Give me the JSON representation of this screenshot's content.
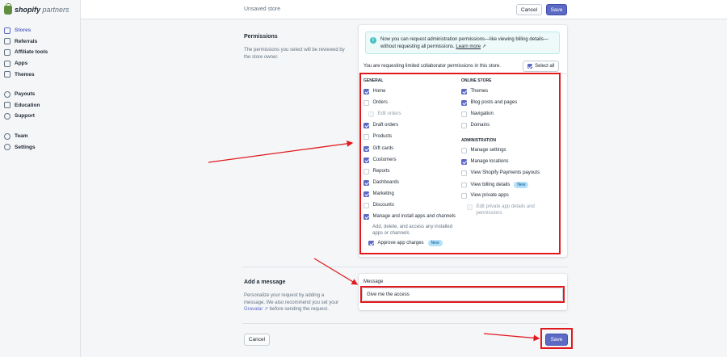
{
  "sidebar": {
    "logo_brand": "shopify",
    "logo_suffix": "partners",
    "items": [
      {
        "label": "Stores",
        "icon": "store-icon"
      },
      {
        "label": "Referrals",
        "icon": "referrals-icon"
      },
      {
        "label": "Affiliate tools",
        "icon": "affiliate-icon"
      },
      {
        "label": "Apps",
        "icon": "apps-icon"
      },
      {
        "label": "Themes",
        "icon": "themes-icon"
      },
      {
        "label": "Payouts",
        "icon": "payouts-icon"
      },
      {
        "label": "Education",
        "icon": "education-icon"
      },
      {
        "label": "Support",
        "icon": "support-icon"
      },
      {
        "label": "Team",
        "icon": "team-icon"
      },
      {
        "label": "Settings",
        "icon": "settings-icon"
      }
    ]
  },
  "topbar": {
    "title": "Unsaved store",
    "cancel_label": "Cancel",
    "save_label": "Save"
  },
  "permissions": {
    "title": "Permissions",
    "description": "The permissions you select will be reviewed by the store owner.",
    "banner_text": "Now you can request administration permissions—like viewing billing details—without requesting all permissions.",
    "banner_link": "Learn more",
    "request_text": "You are requesting limited collaborator permissions in this store.",
    "select_all_label": "Select all",
    "general_heading": "GENERAL",
    "online_store_heading": "ONLINE STORE",
    "administration_heading": "ADMINISTRATION",
    "general": [
      {
        "label": "Home",
        "checked": true
      },
      {
        "label": "Orders",
        "checked": false
      },
      {
        "label": "Edit orders",
        "checked": false,
        "disabled": true
      },
      {
        "label": "Draft orders",
        "checked": true
      },
      {
        "label": "Products",
        "checked": false
      },
      {
        "label": "Gift cards",
        "checked": true
      },
      {
        "label": "Customers",
        "checked": true
      },
      {
        "label": "Reports",
        "checked": false
      },
      {
        "label": "Dashboards",
        "checked": true
      },
      {
        "label": "Marketing",
        "checked": true
      },
      {
        "label": "Discounts",
        "checked": false
      },
      {
        "label": "Manage and install apps and channels",
        "checked": true
      }
    ],
    "apps_help": "Add, delete, and access any installed apps or channels",
    "approve_charges": {
      "label": "Approve app charges",
      "checked": true,
      "badge": "New"
    },
    "online_store": [
      {
        "label": "Themes",
        "checked": true
      },
      {
        "label": "Blog posts and pages",
        "checked": true
      },
      {
        "label": "Navigation",
        "checked": false
      },
      {
        "label": "Domains",
        "checked": false
      }
    ],
    "administration": [
      {
        "label": "Manage settings",
        "checked": false
      },
      {
        "label": "Manage locations",
        "checked": true
      },
      {
        "label": "View Shopify Payments payouts",
        "checked": false
      },
      {
        "label": "View billing details",
        "checked": false,
        "badge": "New"
      },
      {
        "label": "View private apps",
        "checked": false
      }
    ],
    "edit_private_apps": "Edit private app details and permissions"
  },
  "message": {
    "title": "Add a message",
    "desc_part1": "Personalize your request by adding a message. We also recommend you set your",
    "gravatar_link": "Gravatar",
    "desc_part2": "before sending the request.",
    "field_label": "Message",
    "field_value": "Give me the access"
  },
  "footer": {
    "cancel_label": "Cancel",
    "save_label": "Save"
  },
  "colors": {
    "accent": "#5c6ac4",
    "highlight": "#e2191c",
    "banner": "#eef9f9"
  }
}
